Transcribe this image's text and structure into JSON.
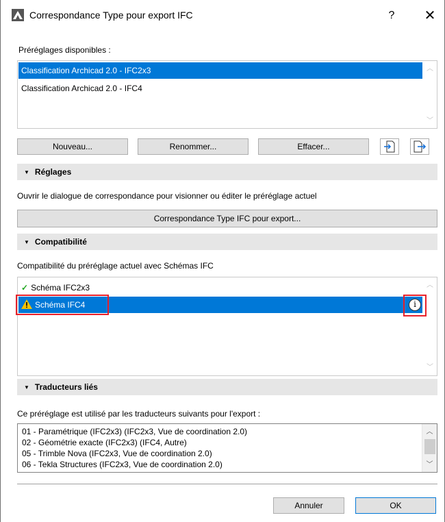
{
  "window": {
    "title": "Correspondance Type pour export IFC",
    "help": "?",
    "close": "✕"
  },
  "presets": {
    "label": "Préréglages disponibles :",
    "items": [
      "Classification Archicad 2.0 - IFC2x3",
      "Classification Archicad 2.0 - IFC4"
    ],
    "selected_index": 0,
    "buttons": {
      "new": "Nouveau...",
      "rename": "Renommer...",
      "delete": "Effacer..."
    },
    "icons": [
      "import-icon",
      "export-icon"
    ]
  },
  "settings": {
    "header": "Réglages",
    "description": "Ouvrir le dialogue de correspondance pour visionner ou éditer le préréglage actuel",
    "button": "Correspondance Type IFC pour export..."
  },
  "compat": {
    "header": "Compatibilité",
    "description": "Compatibilité du préréglage actuel avec Schémas IFC",
    "items": [
      {
        "label": "Schéma IFC2x3",
        "status": "check-icon"
      },
      {
        "label": "Schéma IFC4",
        "status": "warning-icon"
      }
    ],
    "selected_index": 1,
    "info_icon": "info-icon"
  },
  "translators": {
    "header": "Traducteurs liés",
    "description": "Ce préréglage est utilisé par les traducteurs suivants pour l'export :",
    "items": [
      "01 - Paramétrique (IFC2x3) (IFC2x3, Vue de coordination 2.0)",
      "02 - Géométrie exacte (IFC2x3) (IFC4, Autre)",
      "05 - Trimble Nova (IFC2x3, Vue de coordination 2.0)",
      "06 - Tekla Structures (IFC2x3, Vue de coordination 2.0)"
    ]
  },
  "footer": {
    "cancel": "Annuler",
    "ok": "OK"
  },
  "colors": {
    "selection": "#0078d7",
    "highlight": "#e8202a",
    "check": "#22a822",
    "warning": "#f2c200"
  }
}
